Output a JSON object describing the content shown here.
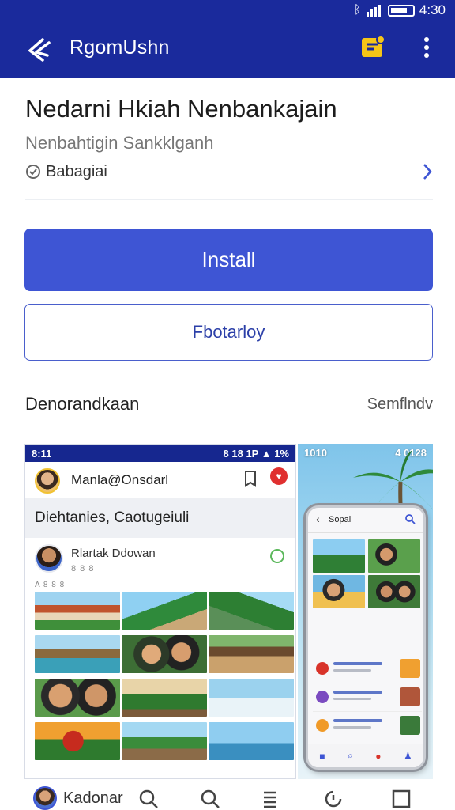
{
  "status_bar": {
    "time": "4:30",
    "icons": [
      "bluetooth-icon",
      "signal-icon",
      "battery-icon"
    ]
  },
  "app_bar": {
    "title": "RgomUshn"
  },
  "app": {
    "name": "Nedarni Hkiah Nenbankajain",
    "developer": "Nenbahtigin Sankklganh",
    "rating_label": "Babagiai"
  },
  "actions": {
    "install_label": "Install",
    "secondary_label": "Fbotarloy"
  },
  "screenshots_section": {
    "title": "Denorandkaan",
    "link": "Semflndv",
    "shot1": {
      "status_left": "8:11",
      "status_right": "8 18 1P ▲ 1%",
      "handle": "Manla@Onsdarl",
      "banner": "Diehtanies, Caotugeiuli",
      "post_name": "Rlartak Ddowan",
      "post_meta": "8 8 8",
      "tag": "A 8 8 8"
    },
    "shot2": {
      "status_left": "1010",
      "status_right": "4 0128",
      "title": "Sopal"
    }
  },
  "bottom_nav": {
    "label": "Kadonar"
  },
  "colors": {
    "primary": "#1a2a9c",
    "accent": "#3e55d4",
    "outline": "#4a5fcc"
  }
}
